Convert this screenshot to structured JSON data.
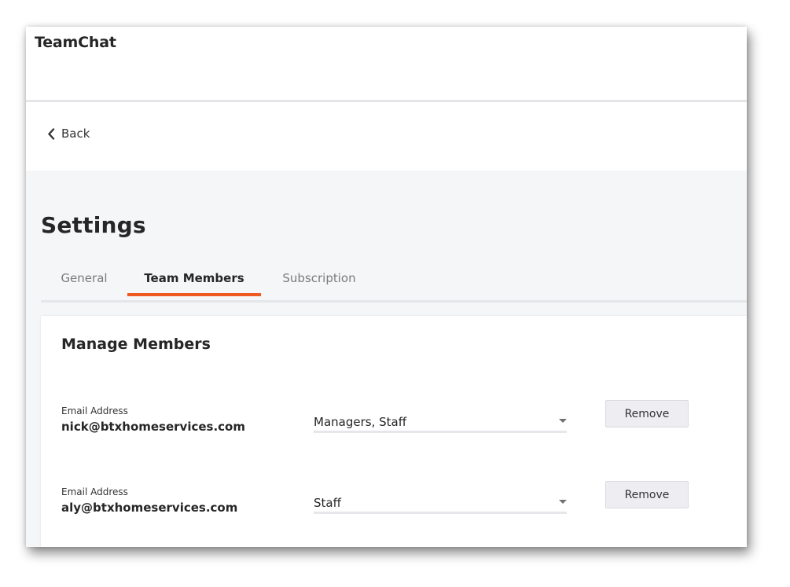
{
  "app": {
    "title": "TeamChat"
  },
  "nav": {
    "back_label": "Back"
  },
  "page": {
    "title": "Settings"
  },
  "tabs": [
    {
      "label": "General",
      "active": false
    },
    {
      "label": "Team Members",
      "active": true
    },
    {
      "label": "Subscription",
      "active": false
    }
  ],
  "manage_members": {
    "title": "Manage Members",
    "members": [
      {
        "email_label": "Email Address",
        "email": "nick@btxhomeservices.com",
        "roles": "Managers, Staff",
        "remove_label": "Remove"
      },
      {
        "email_label": "Email Address",
        "email": "aly@btxhomeservices.com",
        "roles": "Staff",
        "remove_label": "Remove"
      }
    ]
  },
  "colors": {
    "accent": "#f05a22",
    "page_background": "#f5f6f8",
    "surface": "#ffffff",
    "button_background": "#eeeef2"
  },
  "icons": {
    "back": "chevron-left-icon",
    "dropdown": "caret-down-icon"
  }
}
